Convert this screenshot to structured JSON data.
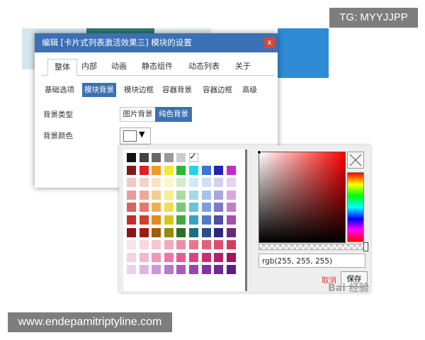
{
  "watermark": {
    "top": "TG: MYYJJPP",
    "bottom": "www.endepamitriptyline.com",
    "baidu": "Bai 经验"
  },
  "dialog": {
    "title": "编辑 [卡片式列表激活效果三] 模块的设置",
    "close_label": "x",
    "main_tabs": [
      "整体",
      "内部",
      "动画",
      "静态组件",
      "动态列表",
      "关于"
    ],
    "active_main_tab": "整体",
    "sub_tabs": [
      "基础选项",
      "模块背景",
      "模块边框",
      "容器背景",
      "容器边框",
      "高级"
    ],
    "active_sub_tab": "模块背景",
    "background_type": {
      "label": "背景类型",
      "options": [
        "图片背景",
        "纯色背景"
      ],
      "selected": "纯色背景"
    },
    "background_color": {
      "label": "背景颜色",
      "value": "#ffffff",
      "dropdown_icon": "▼"
    }
  },
  "color_picker": {
    "check_icon": "✓",
    "grays": [
      "#111111",
      "#444444",
      "#676767",
      "#9a9a9a",
      "#cccccc",
      "#ffffff"
    ],
    "palette_columns": [
      [
        "#7f1a1a",
        "#f3c6c6",
        "#ea9a9a",
        "#dd6060",
        "#c72c2c",
        "#8e1414"
      ],
      [
        "#e41e1e",
        "#f5d2c8",
        "#efa99a",
        "#e7776a",
        "#d33e2f",
        "#9e1e12"
      ],
      [
        "#f49a20",
        "#fae3c4",
        "#f6cb8e",
        "#f1af52",
        "#e38b16",
        "#9f5e0a"
      ],
      [
        "#f2ea2a",
        "#fbf7c8",
        "#f6ee90",
        "#ede052",
        "#d5c61a",
        "#958a0a"
      ],
      [
        "#2bb82c",
        "#d2ecca",
        "#aadca0",
        "#7cc772",
        "#47a83e",
        "#2a6f22"
      ],
      [
        "#22d4e8",
        "#cfeaf2",
        "#a3d8e6",
        "#6cc3d8",
        "#33a3be",
        "#1a6e83"
      ],
      [
        "#3c74d6",
        "#d2dff5",
        "#a9c2ec",
        "#7ca0dd",
        "#4e79c7",
        "#2a4c8c"
      ],
      [
        "#2424b4",
        "#d4d0ee",
        "#aba6dc",
        "#7f78c6",
        "#544aa8",
        "#2f2776"
      ],
      [
        "#c12ad0",
        "#ead0ee",
        "#d9a8e0",
        "#c47ccc",
        "#a64eb2",
        "#6c2878"
      ]
    ],
    "extra_rows": [
      [
        "#f5e4e8",
        "#f9d6de",
        "#f6c5d2",
        "#f0a9bc",
        "#ea8fa6",
        "#e57891",
        "#e0617e",
        "#dc4e70",
        "#d63c62"
      ],
      [
        "#f2d3e2",
        "#f3b7cf",
        "#ee97ba",
        "#e978a6",
        "#e35c93",
        "#d94383",
        "#ca2d74",
        "#b52068",
        "#a0155d"
      ],
      [
        "#ead2ec",
        "#dcb6e2",
        "#cc97d6",
        "#ba78c8",
        "#a85cba",
        "#9447ad",
        "#80369e",
        "#6d2a8f",
        "#5c2080"
      ]
    ],
    "sv_hue": "#ff0000",
    "color_text": "rgb(255, 255, 255)",
    "cancel_label": "取消",
    "save_label": "保存"
  }
}
